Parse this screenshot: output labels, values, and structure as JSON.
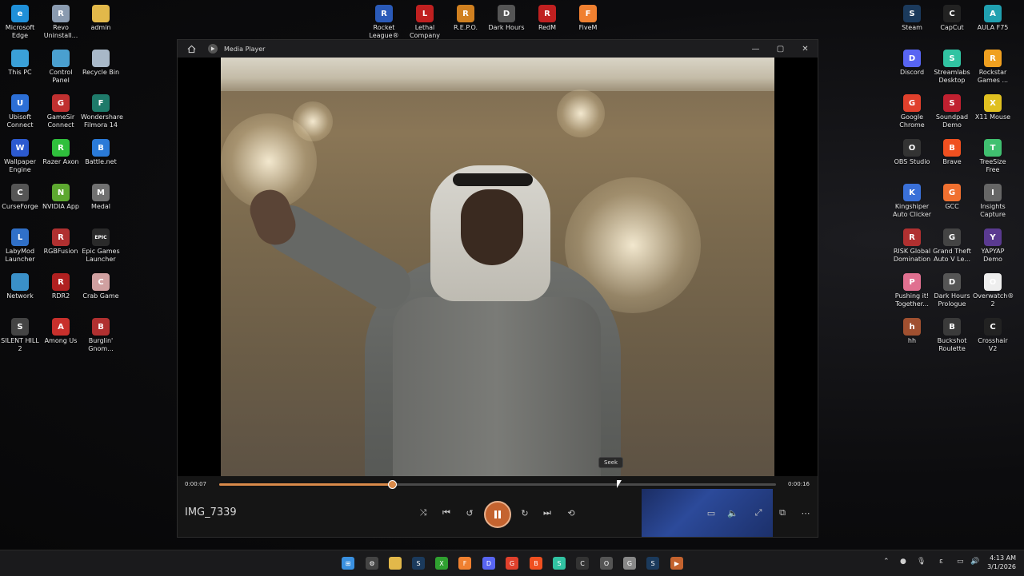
{
  "desktop": {
    "left_icons": [
      {
        "label": "Microsoft Edge",
        "color": "#1f8fd8",
        "glyph": "e"
      },
      {
        "label": "Revo Uninstall...",
        "color": "#8a9bb0",
        "glyph": "R"
      },
      {
        "label": "admin",
        "color": "#e2b84a",
        "glyph": ""
      },
      {
        "label": "This PC",
        "color": "#3aa0d8",
        "glyph": ""
      },
      {
        "label": "Control Panel",
        "color": "#4aa0d0",
        "glyph": ""
      },
      {
        "label": "Recycle Bin",
        "color": "#a8b8c8",
        "glyph": ""
      },
      {
        "label": "Ubisoft Connect",
        "color": "#2c6fd6",
        "glyph": "U"
      },
      {
        "label": "GameSir Connect",
        "color": "#c03030",
        "glyph": "G"
      },
      {
        "label": "Wondershare Filmora 14",
        "color": "#1e7a6a",
        "glyph": "F"
      },
      {
        "label": "Wallpaper Engine",
        "color": "#2c5ad0",
        "glyph": "W"
      },
      {
        "label": "Razer Axon",
        "color": "#2fbf3c",
        "glyph": "R"
      },
      {
        "label": "Battle.net",
        "color": "#2a7ad8",
        "glyph": "B"
      },
      {
        "label": "CurseForge",
        "color": "#555555",
        "glyph": "C"
      },
      {
        "label": "NVIDIA App",
        "color": "#5da830",
        "glyph": "N"
      },
      {
        "label": "Medal",
        "color": "#707070",
        "glyph": "M"
      },
      {
        "label": "LabyMod Launcher",
        "color": "#3070c8",
        "glyph": "L"
      },
      {
        "label": "RGBFusion",
        "color": "#b03030",
        "glyph": "R"
      },
      {
        "label": "Epic Games Launcher",
        "color": "#2a2a2a",
        "glyph": "EPIC"
      },
      {
        "label": "Network",
        "color": "#3a90c8",
        "glyph": ""
      },
      {
        "label": "RDR2",
        "color": "#b02020",
        "glyph": "R"
      },
      {
        "label": "Crab Game",
        "color": "#d0a0a0",
        "glyph": "C"
      },
      {
        "label": "SILENT HILL 2",
        "color": "#444444",
        "glyph": "S"
      },
      {
        "label": "Among Us",
        "color": "#c8302c",
        "glyph": "A"
      },
      {
        "label": "Burglin' Gnom...",
        "color": "#b03030",
        "glyph": "B"
      }
    ],
    "top_icons": [
      {
        "label": "Rocket League®",
        "color": "#2a5ab8",
        "glyph": "R"
      },
      {
        "label": "Lethal Company",
        "color": "#c02020",
        "glyph": "L"
      },
      {
        "label": "R.E.P.O.",
        "color": "#d08020",
        "glyph": "R"
      },
      {
        "label": "Dark Hours",
        "color": "#555555",
        "glyph": "D"
      },
      {
        "label": "RedM",
        "color": "#c02020",
        "glyph": "R"
      },
      {
        "label": "FiveM",
        "color": "#f08030",
        "glyph": "F"
      }
    ],
    "right_icons": [
      {
        "label": "Steam",
        "color": "#1b3a5c",
        "glyph": "S"
      },
      {
        "label": "CapCut",
        "color": "#222222",
        "glyph": "C"
      },
      {
        "label": "AULA F75",
        "color": "#20a0b0",
        "glyph": "A"
      },
      {
        "label": "Discord",
        "color": "#5865f2",
        "glyph": "D"
      },
      {
        "label": "Streamlabs Desktop",
        "color": "#31c3a2",
        "glyph": "S"
      },
      {
        "label": "Rockstar Games ...",
        "color": "#f0a020",
        "glyph": "R"
      },
      {
        "label": "Google Chrome",
        "color": "#e0402c",
        "glyph": "G"
      },
      {
        "label": "Soundpad Demo",
        "color": "#c02030",
        "glyph": "S"
      },
      {
        "label": "X11 Mouse",
        "color": "#e0c020",
        "glyph": "X"
      },
      {
        "label": "OBS Studio",
        "color": "#333333",
        "glyph": "O"
      },
      {
        "label": "Brave",
        "color": "#f05020",
        "glyph": "B"
      },
      {
        "label": "TreeSize Free",
        "color": "#40c070",
        "glyph": "T"
      },
      {
        "label": "Kingshiper Auto Clicker",
        "color": "#3a70d8",
        "glyph": "K"
      },
      {
        "label": "GCC",
        "color": "#f07030",
        "glyph": "G"
      },
      {
        "label": "Insights Capture",
        "color": "#666666",
        "glyph": "I"
      },
      {
        "label": "RISK Global Domination",
        "color": "#b03030",
        "glyph": "R"
      },
      {
        "label": "Grand Theft Auto V Le...",
        "color": "#444444",
        "glyph": "G"
      },
      {
        "label": "YAPYAP Demo",
        "color": "#5a3a90",
        "glyph": "Y"
      },
      {
        "label": "Pushing it! Together...",
        "color": "#e07090",
        "glyph": "P"
      },
      {
        "label": "Dark Hours Prologue",
        "color": "#555555",
        "glyph": "D"
      },
      {
        "label": "Overwatch® 2",
        "color": "#eeeeee",
        "glyph": "O"
      },
      {
        "label": "hh",
        "color": "#a05030",
        "glyph": "h"
      },
      {
        "label": "Buckshot Roulette",
        "color": "#3a3a3a",
        "glyph": "B"
      },
      {
        "label": "Crosshair V2",
        "color": "#222222",
        "glyph": "C"
      }
    ]
  },
  "player": {
    "app_title": "Media Player",
    "file_name": "IMG_7339",
    "current_time": "0:00:07",
    "total_time": "0:00:16",
    "progress": 0.31,
    "tooltip": "Seek",
    "accent": "#d98a4a",
    "controls": [
      {
        "name": "shuffle-button",
        "icon": "⤨"
      },
      {
        "name": "previous-button",
        "icon": "⏮"
      },
      {
        "name": "rewind-10-button",
        "icon": "↺"
      },
      {
        "name": "forward-30-button",
        "icon": "↻"
      },
      {
        "name": "next-button",
        "icon": "⏭"
      },
      {
        "name": "repeat-button",
        "icon": "⟲"
      }
    ],
    "right_controls": [
      {
        "name": "captions-button",
        "icon": "▭"
      },
      {
        "name": "volume-button",
        "icon": "🔈"
      },
      {
        "name": "fullscreen-button",
        "icon": "⤢"
      },
      {
        "name": "miniplayer-button",
        "icon": "⧉"
      },
      {
        "name": "more-button",
        "icon": "⋯"
      }
    ]
  },
  "taskbar": {
    "clock_time": "4:13 AM",
    "clock_date": "3/1/2026",
    "apps": [
      {
        "name": "start-button",
        "color": "#3a90e0",
        "glyph": "⊞"
      },
      {
        "name": "settings-app",
        "color": "#444444",
        "glyph": "⚙"
      },
      {
        "name": "file-explorer-app",
        "color": "#e2b84a",
        "glyph": ""
      },
      {
        "name": "steam-app",
        "color": "#1b3a5c",
        "glyph": "S"
      },
      {
        "name": "xbox-app",
        "color": "#2fa030",
        "glyph": "X"
      },
      {
        "name": "fivem-app",
        "color": "#f08030",
        "glyph": "F"
      },
      {
        "name": "discord-app",
        "color": "#5865f2",
        "glyph": "D"
      },
      {
        "name": "chrome-app",
        "color": "#e0402c",
        "glyph": "G"
      },
      {
        "name": "brave-app",
        "color": "#f05020",
        "glyph": "B"
      },
      {
        "name": "streamlabs-app",
        "color": "#31c3a2",
        "glyph": "S"
      },
      {
        "name": "capcut-app",
        "color": "#333333",
        "glyph": "C"
      },
      {
        "name": "obs-app",
        "color": "#555555",
        "glyph": "O"
      },
      {
        "name": "gcc-app",
        "color": "#888888",
        "glyph": "G"
      },
      {
        "name": "steam-app-2",
        "color": "#1b3a5c",
        "glyph": "S"
      },
      {
        "name": "media-player-app",
        "color": "#c4632f",
        "glyph": "▶"
      }
    ]
  }
}
